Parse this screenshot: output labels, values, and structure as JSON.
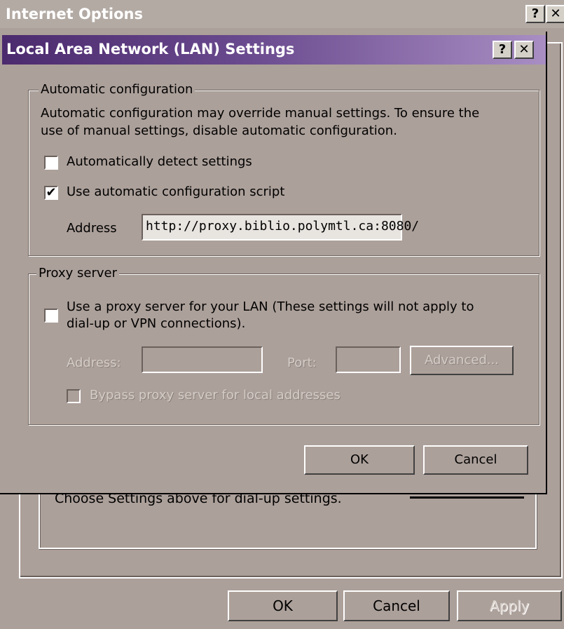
{
  "parent_window": {
    "title": "Internet Options",
    "help_glyph": "?",
    "close_glyph": "✕",
    "hint_text": "Choose Settings above for dial-up settings.",
    "buttons": {
      "ok": "OK",
      "cancel": "Cancel",
      "apply": "Apply"
    }
  },
  "dialog": {
    "title": "Local Area Network (LAN) Settings",
    "help_glyph": "?",
    "close_glyph": "✕",
    "auto_config": {
      "legend": "Automatic configuration",
      "description_line1": "Automatic configuration may override manual settings.  To ensure the",
      "description_line2": "use of manual settings, disable automatic configuration.",
      "detect_label": "Automatically detect settings",
      "detect_checked": false,
      "script_label": "Use automatic configuration script",
      "script_checked": true,
      "address_label": "Address",
      "address_value": "http://proxy.biblio.polymtl.ca:8080/"
    },
    "proxy": {
      "legend": "Proxy server",
      "use_proxy_line1": "Use a proxy server for your LAN (These settings will not apply to",
      "use_proxy_line2": "dial-up or VPN connections).",
      "use_proxy_checked": false,
      "address_label": "Address:",
      "address_value": "",
      "port_label": "Port:",
      "port_value": "",
      "advanced_label": "Advanced...",
      "bypass_label": "Bypass proxy server for local addresses",
      "bypass_checked": false
    },
    "buttons": {
      "ok": "OK",
      "cancel": "Cancel"
    }
  },
  "check_glyph": "✔"
}
